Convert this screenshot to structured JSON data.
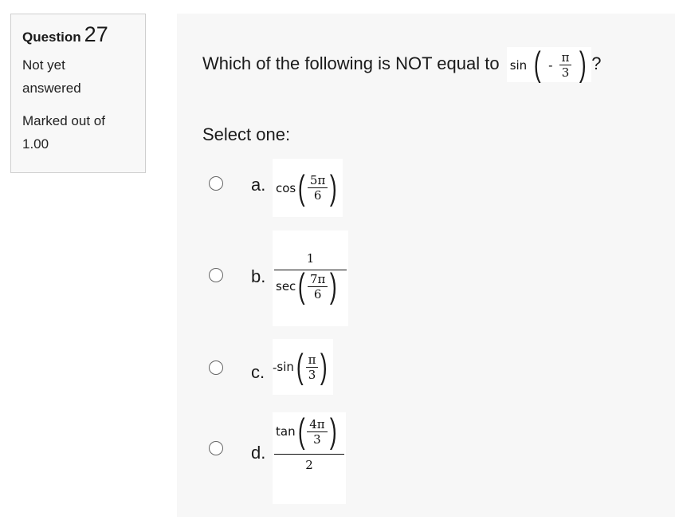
{
  "info": {
    "question_label": "Question",
    "question_number": "27",
    "state": "Not yet answered",
    "grade": "Marked out of 1.00"
  },
  "question": {
    "text": "Which of the following is NOT equal to",
    "expr": {
      "func": "sin",
      "sign": "-",
      "num": "π",
      "den": "3"
    },
    "end": "?"
  },
  "prompt": "Select one:",
  "options": [
    {
      "letter": "a.",
      "func": "cos",
      "num": "5π",
      "den": "6"
    },
    {
      "letter": "b.",
      "top": "1",
      "func": "sec",
      "num": "7π",
      "den": "6"
    },
    {
      "letter": "c.",
      "prefix": "-",
      "func": "sin",
      "num": "π",
      "den": "3"
    },
    {
      "letter": "d.",
      "func": "tan",
      "num": "4π",
      "den": "3",
      "bottom": "2"
    }
  ]
}
